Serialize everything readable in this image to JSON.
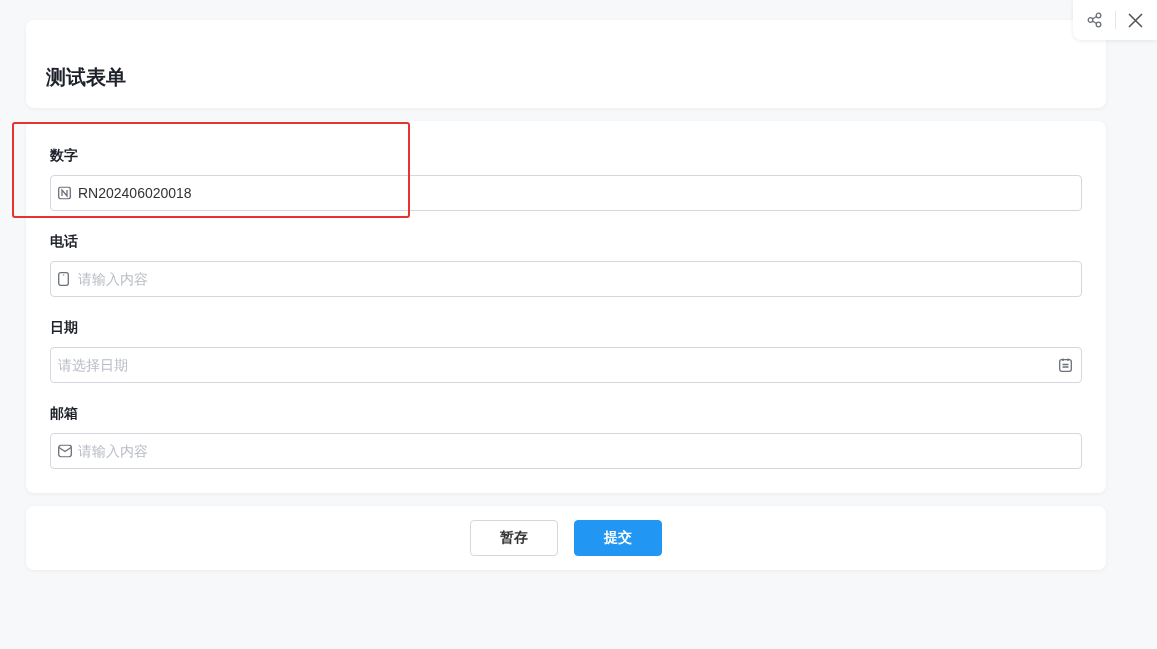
{
  "form_title": "测试表单",
  "fields": [
    {
      "kind": "number",
      "label": "数字",
      "value": "RN202406020018",
      "highlighted": true
    },
    {
      "kind": "phone",
      "label": "电话",
      "placeholder": "请输入内容",
      "highlighted": false
    },
    {
      "kind": "date",
      "label": "日期",
      "placeholder": "请选择日期",
      "highlighted": false
    },
    {
      "kind": "email",
      "label": "邮箱",
      "placeholder": "请输入内容",
      "highlighted": false
    }
  ],
  "buttons": [
    {
      "label": "暂存",
      "kind": "secondary"
    },
    {
      "label": "提交",
      "kind": "primary"
    }
  ]
}
